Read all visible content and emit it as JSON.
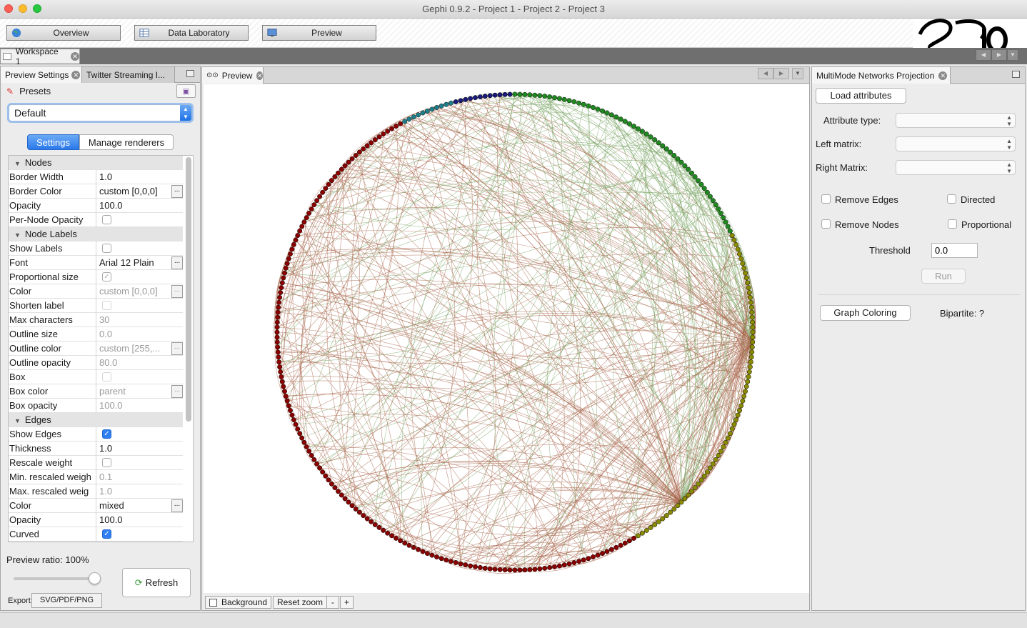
{
  "window": {
    "title": "Gephi 0.9.2 - Project 1 - Project 2 - Project 3"
  },
  "modes": {
    "overview": "Overview",
    "data_laboratory": "Data Laboratory",
    "preview": "Preview"
  },
  "workspace": {
    "tab": "Workspace 1"
  },
  "left_panel": {
    "tabs": [
      "Preview Settings",
      "Twitter Streaming I..."
    ],
    "presets_label": "Presets",
    "preset_value": "Default",
    "segments": {
      "settings": "Settings",
      "manage_renderers": "Manage renderers"
    },
    "rows": [
      {
        "type": "cat",
        "key": "Nodes"
      },
      {
        "key": "Border Width",
        "value": "1.0"
      },
      {
        "key": "Border Color",
        "value": "custom [0,0,0]",
        "ellipsis": true
      },
      {
        "key": "Opacity",
        "value": "100.0"
      },
      {
        "key": "Per-Node Opacity",
        "check": "off"
      },
      {
        "type": "cat",
        "key": "Node Labels"
      },
      {
        "key": "Show Labels",
        "check": "off"
      },
      {
        "key": "Font",
        "value": "Arial 12 Plain",
        "ellipsis": true
      },
      {
        "key": "Proportional size",
        "check": "dim"
      },
      {
        "key": "Color",
        "value": "custom [0,0,0]",
        "ellipsis": true,
        "dim": true
      },
      {
        "key": "Shorten label",
        "check": "offdim"
      },
      {
        "key": "Max characters",
        "value": "30",
        "dim": true
      },
      {
        "key": "Outline size",
        "value": "0.0",
        "dim": true
      },
      {
        "key": "Outline color",
        "value": "custom [255,...",
        "ellipsis": true,
        "dim": true
      },
      {
        "key": "Outline opacity",
        "value": "80.0",
        "dim": true
      },
      {
        "key": "Box",
        "check": "offdim"
      },
      {
        "key": "Box color",
        "value": "parent",
        "ellipsis": true,
        "dim": true
      },
      {
        "key": "Box opacity",
        "value": "100.0",
        "dim": true
      },
      {
        "type": "cat",
        "key": "Edges"
      },
      {
        "key": "Show Edges",
        "check": "on"
      },
      {
        "key": "Thickness",
        "value": "1.0"
      },
      {
        "key": "Rescale weight",
        "check": "off"
      },
      {
        "key": "Min. rescaled weigh",
        "value": "0.1",
        "dim": true
      },
      {
        "key": "Max. rescaled weig",
        "value": "1.0",
        "dim": true
      },
      {
        "key": "Color",
        "value": "mixed",
        "ellipsis": true
      },
      {
        "key": "Opacity",
        "value": "100.0"
      },
      {
        "key": "Curved",
        "check": "on"
      }
    ],
    "preview_ratio_label": "Preview ratio:",
    "preview_ratio_value": "100%",
    "preview_ratio": 1.0,
    "refresh": "Refresh",
    "export_label": "Export:",
    "export_button": "SVG/PDF/PNG"
  },
  "preview_panel": {
    "tab": "Preview",
    "background": "Background",
    "reset_zoom": "Reset zoom",
    "zoom_out": "-",
    "zoom_in": "+"
  },
  "right_panel": {
    "tab": "MultiMode Networks Projection",
    "load_attributes": "Load attributes",
    "attribute_type": "Attribute type:",
    "left_matrix": "Left matrix:",
    "right_matrix": "Right Matrix:",
    "remove_edges": "Remove Edges",
    "directed": "Directed",
    "remove_nodes": "Remove Nodes",
    "proportional": "Proportional",
    "threshold_label": "Threshold",
    "threshold_value": "0.0",
    "run": "Run",
    "graph_coloring": "Graph Coloring",
    "bipartite": "Bipartite: ?"
  },
  "colors": {
    "accent": "#2f7ff2",
    "node_red": "#8b0000",
    "node_olive": "#8b8b00",
    "node_green": "#1f8a1f",
    "node_navy": "#1a1a7a",
    "node_teal": "#1f7f8a"
  }
}
